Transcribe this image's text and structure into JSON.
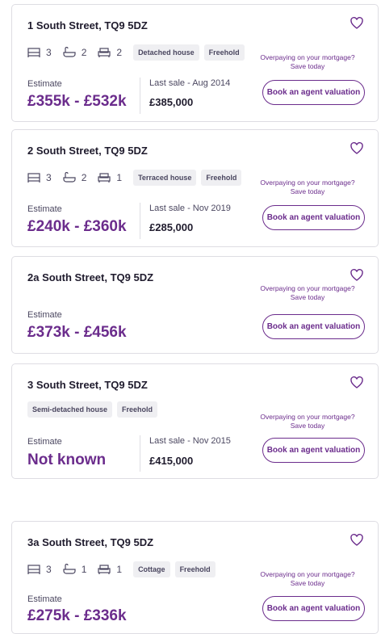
{
  "accent_color": "#6b2c8c",
  "promo_text": "Overpaying on your mortgage? Save today",
  "book_label": "Book an agent valuation",
  "estimate_label": "Estimate",
  "cards": [
    {
      "title": "1 South Street, TQ9 5DZ",
      "beds": "3",
      "baths": "2",
      "receptions": "2",
      "tags": [
        "Detached house",
        "Freehold"
      ],
      "estimate": "£355k - £532k",
      "last_sale_label": "Last sale - Aug 2014",
      "last_sale_price": "£385,000"
    },
    {
      "title": "2 South Street, TQ9 5DZ",
      "beds": "3",
      "baths": "2",
      "receptions": "1",
      "tags": [
        "Terraced house",
        "Freehold"
      ],
      "estimate": "£240k - £360k",
      "last_sale_label": "Last sale - Nov 2019",
      "last_sale_price": "£285,000"
    },
    {
      "title": "2a South Street, TQ9 5DZ",
      "estimate": "£373k - £456k"
    },
    {
      "title": "3 South Street, TQ9 5DZ",
      "tags": [
        "Semi-detached house",
        "Freehold"
      ],
      "estimate": "Not known",
      "last_sale_label": "Last sale - Nov 2015",
      "last_sale_price": "£415,000"
    },
    {
      "title": "3a South Street, TQ9 5DZ",
      "beds": "3",
      "baths": "1",
      "receptions": "1",
      "tags": [
        "Cottage",
        "Freehold"
      ],
      "estimate": "£275k - £336k"
    }
  ]
}
